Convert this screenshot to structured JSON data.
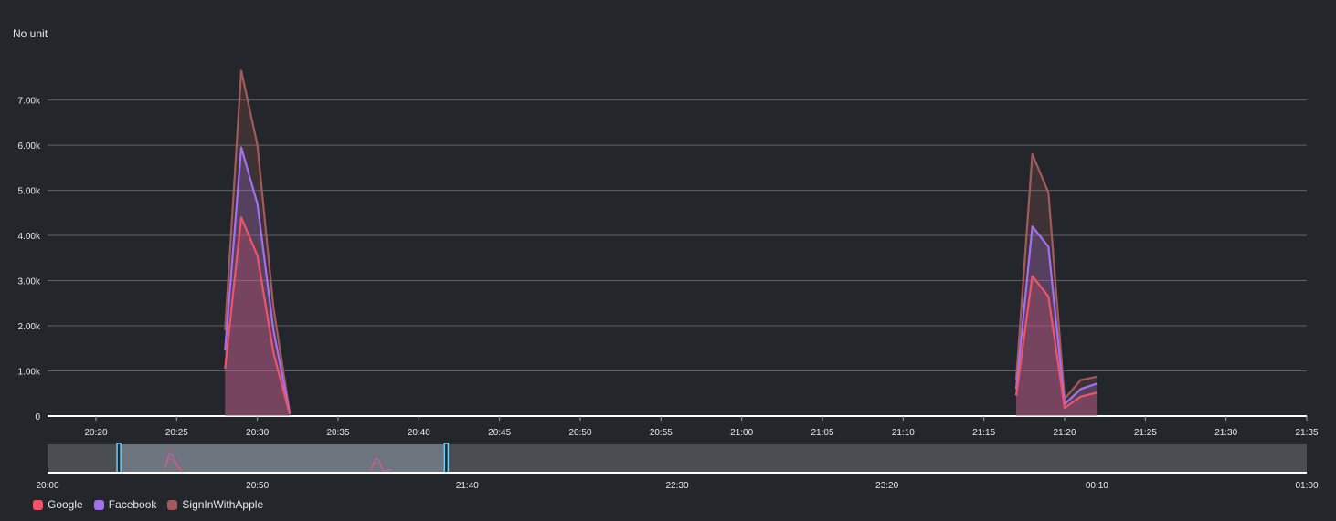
{
  "chart_data": {
    "type": "area",
    "ylabel": "No unit",
    "ylim": [
      0,
      7800
    ],
    "yticks": [
      0,
      1000,
      2000,
      3000,
      4000,
      5000,
      6000,
      7000
    ],
    "ytick_labels": [
      "0",
      "1.00k",
      "2.00k",
      "3.00k",
      "4.00k",
      "5.00k",
      "6.00k",
      "7.00k"
    ],
    "xlim": [
      "20:17",
      "21:35"
    ],
    "xtick_labels": [
      "20:20",
      "20:25",
      "20:30",
      "20:35",
      "20:40",
      "20:45",
      "20:50",
      "20:55",
      "21:00",
      "21:05",
      "21:10",
      "21:15",
      "21:20",
      "21:25",
      "21:30",
      "21:35"
    ],
    "grid": true,
    "stacked": true,
    "legend_position": "bottom-left",
    "colors": {
      "Google": "#f1536a",
      "Facebook": "#a370f0",
      "SignInWithApple": "#a35a5a"
    },
    "series": [
      {
        "name": "Google",
        "points": [
          [
            "20:28",
            1050
          ],
          [
            "20:29",
            4400
          ],
          [
            "20:30",
            3550
          ],
          [
            "20:31",
            1400
          ],
          [
            "20:32",
            40
          ],
          [
            "21:17",
            450
          ],
          [
            "21:18",
            3100
          ],
          [
            "21:19",
            2650
          ],
          [
            "21:20",
            180
          ],
          [
            "21:21",
            430
          ],
          [
            "21:22",
            520
          ]
        ]
      },
      {
        "name": "Facebook",
        "points": [
          [
            "20:28",
            1450
          ],
          [
            "20:29",
            5950
          ],
          [
            "20:30",
            4700
          ],
          [
            "20:31",
            1900
          ],
          [
            "20:32",
            60
          ],
          [
            "21:17",
            600
          ],
          [
            "21:18",
            4200
          ],
          [
            "21:19",
            3750
          ],
          [
            "21:20",
            260
          ],
          [
            "21:21",
            600
          ],
          [
            "21:22",
            720
          ]
        ]
      },
      {
        "name": "SignInWithApple",
        "points": [
          [
            "20:28",
            1900
          ],
          [
            "20:29",
            7650
          ],
          [
            "20:30",
            6000
          ],
          [
            "20:31",
            2400
          ],
          [
            "20:32",
            80
          ],
          [
            "21:17",
            800
          ],
          [
            "21:18",
            5800
          ],
          [
            "21:19",
            4950
          ],
          [
            "21:20",
            380
          ],
          [
            "21:21",
            800
          ],
          [
            "21:22",
            870
          ]
        ]
      }
    ],
    "overview": {
      "xlim": [
        "20:00",
        "01:00"
      ],
      "xtick_labels": [
        "20:00",
        "20:50",
        "21:40",
        "22:30",
        "23:20",
        "00:10",
        "01:00"
      ],
      "selection": [
        "20:17",
        "21:35"
      ]
    }
  }
}
